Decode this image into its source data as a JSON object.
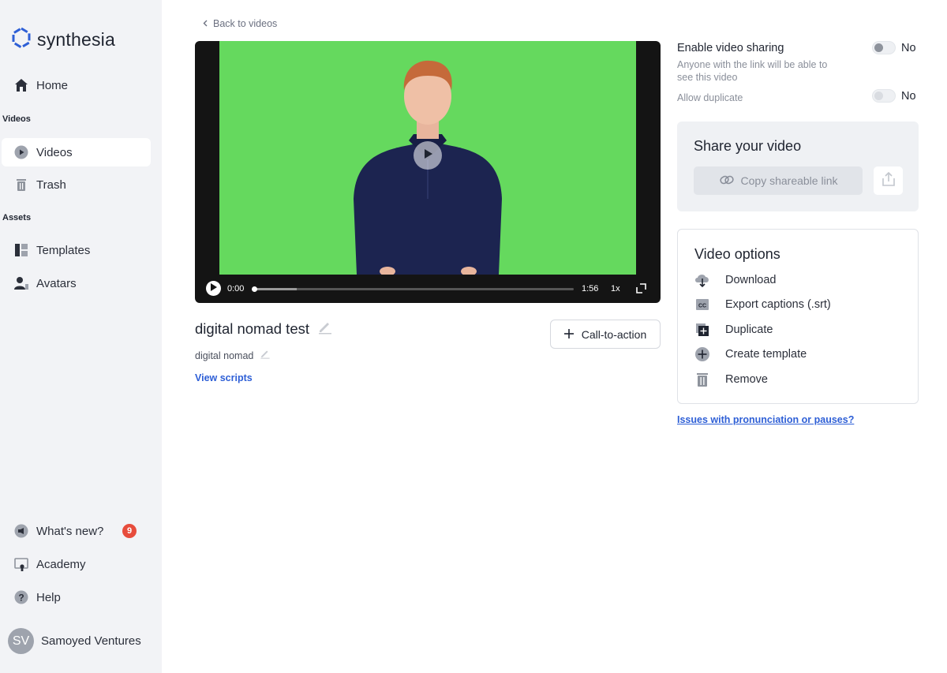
{
  "brand": {
    "name": "synthesia",
    "accent": "#2e5fd6"
  },
  "sidebar": {
    "home": "Home",
    "section_videos": "Videos",
    "videos": "Videos",
    "trash": "Trash",
    "section_assets": "Assets",
    "templates": "Templates",
    "avatars": "Avatars",
    "whats_new": "What's new?",
    "whats_new_count": "9",
    "academy": "Academy",
    "help": "Help",
    "user_initials": "SV",
    "user_name": "Samoyed Ventures"
  },
  "main": {
    "back": "Back to videos",
    "player": {
      "current_time": "0:00",
      "duration": "1:56",
      "speed": "1x",
      "progress": 0.0
    },
    "video_title": "digital nomad test",
    "video_subtitle": "digital nomad",
    "view_scripts": "View scripts",
    "cta_label": "Call-to-action"
  },
  "right": {
    "sharing_label": "Enable video sharing",
    "sharing_desc": "Anyone with the link will be able to see this video",
    "sharing_value": "No",
    "duplicate_label": "Allow duplicate",
    "duplicate_value": "No",
    "share_title": "Share your video",
    "copy_link": "Copy shareable link",
    "options_title": "Video options",
    "options": {
      "download": "Download",
      "captions": "Export captions (.srt)",
      "duplicate": "Duplicate",
      "template": "Create template",
      "remove": "Remove"
    },
    "issues_link": "Issues with pronunciation or pauses?"
  }
}
